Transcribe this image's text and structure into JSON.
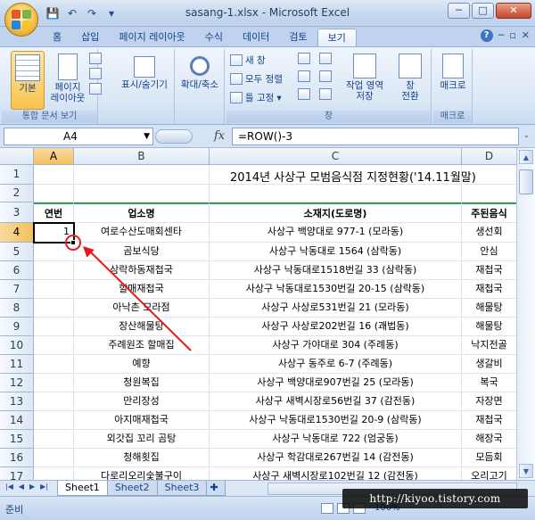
{
  "window": {
    "title": "sasang-1.xlsx - Microsoft Excel",
    "min_label": "─",
    "max_label": "□",
    "close_label": "✕"
  },
  "qat": {
    "save": "💾",
    "undo": "↶",
    "redo": "↷",
    "more": "▾"
  },
  "tabs": [
    "홈",
    "삽입",
    "페이지 레이아웃",
    "수식",
    "데이터",
    "검토",
    "보기"
  ],
  "active_tab": "보기",
  "tab_right": {
    "help": "?",
    "min": "─",
    "restore": "▫",
    "close": "✕"
  },
  "ribbon": {
    "workbook_views": {
      "label": "통합 문서 보기",
      "normal": "기본",
      "page_layout_1": "페이지",
      "page_layout_2": "레이아웃"
    },
    "show_hide": {
      "label": "표시/숨기기"
    },
    "zoom": {
      "label": "확대/축소"
    },
    "window": {
      "label": "창",
      "new_window": "새 창",
      "arrange_all": "모두 정렬",
      "freeze_panes": "틀 고정",
      "save_workspace_1": "작업 영역",
      "save_workspace_2": "저장",
      "switch_windows_1": "창",
      "switch_windows_2": "전환"
    },
    "macros": {
      "label": "매크로",
      "button": "매크로"
    }
  },
  "formula_bar": {
    "name_box": "A4",
    "fx": "fx",
    "formula": "=ROW()-3"
  },
  "columns": [
    "A",
    "B",
    "C",
    "D"
  ],
  "active_column": "A",
  "rows": [
    "1",
    "2",
    "3",
    "4",
    "5",
    "6",
    "7",
    "8",
    "9",
    "10",
    "11",
    "12",
    "13",
    "14",
    "15",
    "16",
    "17"
  ],
  "active_row": "4",
  "sheet": {
    "title": "2014년 사상구 모범음식점 지정현황('14.11월말)",
    "headers": [
      "연번",
      "업소명",
      "소재지(도로명)",
      "주된음식"
    ],
    "data": [
      [
        "1",
        "여로수산도매회센타",
        "사상구 백양대로 977-1 (모라동)",
        "생선회"
      ],
      [
        "",
        "곰보식당",
        "사상구 낙동대로 1564 (삼락동)",
        "안심"
      ],
      [
        "",
        "삼락하동재첩국",
        "사상구 낙동대로1518번길 33 (삼락동)",
        "재첩국"
      ],
      [
        "",
        "할매재첩국",
        "사상구 낙동대로1530번길 20-15 (삼락동)",
        "재첩국"
      ],
      [
        "",
        "아낙촌 모라점",
        "사상구 사상로531번길 21 (모라동)",
        "해물탕"
      ],
      [
        "",
        "장산해물탕",
        "사상구 사상로202번길 16 (괘법동)",
        "해물탕"
      ],
      [
        "",
        "주례원조 할매집",
        "사상구 가야대로 304 (주례동)",
        "낙지전골"
      ],
      [
        "",
        "예향",
        "사상구 동주로 6-7 (주례동)",
        "생갈비"
      ],
      [
        "",
        "청원복집",
        "사상구 백양대로907번길 25 (모라동)",
        "복국"
      ],
      [
        "",
        "만리장성",
        "사상구 새벽시장로56번길 37 (감전동)",
        "자장면"
      ],
      [
        "",
        "아지매재첩국",
        "사상구 낙동대로1530번길 20-9 (삼락동)",
        "재첩국"
      ],
      [
        "",
        "외갓집 꼬리 곰탕",
        "사상구 낙동대로 722 (엄궁동)",
        "해장국"
      ],
      [
        "",
        "청해횟집",
        "사상구 학감대로267번길 14 (감전동)",
        "모듬회"
      ],
      [
        "",
        "다로리오리숯불구이",
        "사상구 새벽시장로102번길 12 (감전동)",
        "오리고기"
      ]
    ]
  },
  "sheet_tabs": [
    "Sheet1",
    "Sheet2",
    "Sheet3"
  ],
  "status": {
    "ready": "준비",
    "zoom": "100%"
  },
  "watermark": "http://kiyoo.tistory.com"
}
